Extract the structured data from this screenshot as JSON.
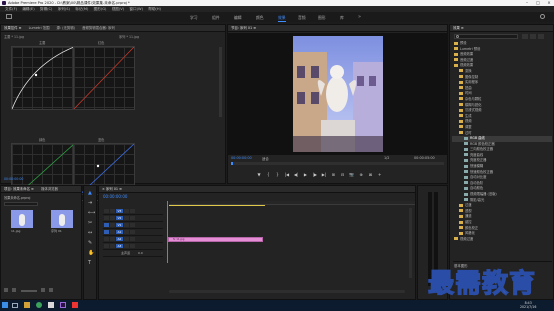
{
  "app": {
    "title": "Adobe Premiere Pro 2020 - D:\\教案\\00\\精品课件\\效果集-未命名.prproj *",
    "window_controls": [
      "–",
      "□",
      "×"
    ]
  },
  "menu": [
    "文件(F)",
    "编辑(E)",
    "剪辑(C)",
    "序列(S)",
    "标记(M)",
    "图形(G)",
    "视图(V)",
    "窗口(W)",
    "帮助(H)"
  ],
  "workspaces": [
    "学习",
    "组件",
    "编辑",
    "颜色",
    "效果",
    "音频",
    "图形",
    "库"
  ],
  "active_workspace": "效果",
  "effect_controls": {
    "tabs": [
      "效果控件 ≡",
      "Lumetri 范围",
      "源: (无剪辑)",
      "音频剪辑混合器: 序列"
    ],
    "header_left": "主要 * 11.jpg",
    "header_right": "序列 * 11.jpg",
    "graph_labels": [
      "主要",
      "红色",
      "绿色",
      "蓝色"
    ],
    "time": "00:00:00:00"
  },
  "program_monitor": {
    "title": "节目: 序列 01 ≡",
    "timecode": "00:00:00:00",
    "fit": "适合",
    "scale": "1/2",
    "duration": "00:00:05:00",
    "controls": [
      "▼",
      "{",
      "}",
      "|◀",
      "◀|",
      "▶",
      "|▶",
      "▶|",
      "⊞",
      "⊟",
      "📷",
      "⊕",
      "⊠",
      "+"
    ]
  },
  "effects_panel": {
    "title": "效果 ≡",
    "search_placeholder": "",
    "items": [
      {
        "label": "预设",
        "type": "folder",
        "indent": 0
      },
      {
        "label": "Lumetri 预设",
        "type": "folder",
        "indent": 0
      },
      {
        "label": "音频效果",
        "type": "folder",
        "indent": 0
      },
      {
        "label": "音频过渡",
        "type": "folder",
        "indent": 0
      },
      {
        "label": "视频效果",
        "type": "folder",
        "indent": 0
      },
      {
        "label": "变换",
        "type": "folder",
        "indent": 1
      },
      {
        "label": "图像控制",
        "type": "folder",
        "indent": 1
      },
      {
        "label": "实用程序",
        "type": "folder",
        "indent": 1
      },
      {
        "label": "扭曲",
        "type": "folder",
        "indent": 1
      },
      {
        "label": "时间",
        "type": "folder",
        "indent": 1
      },
      {
        "label": "杂色与颗粒",
        "type": "folder",
        "indent": 1
      },
      {
        "label": "模糊与锐化",
        "type": "folder",
        "indent": 1
      },
      {
        "label": "沉浸式视频",
        "type": "folder",
        "indent": 1
      },
      {
        "label": "生成",
        "type": "folder",
        "indent": 1
      },
      {
        "label": "视频",
        "type": "folder",
        "indent": 1
      },
      {
        "label": "调整",
        "type": "folder",
        "indent": 1
      },
      {
        "label": "过时",
        "type": "folder",
        "indent": 1
      },
      {
        "label": "RGB 曲线",
        "type": "fx",
        "indent": 2,
        "selected": true
      },
      {
        "label": "RGB 颜色校正器",
        "type": "fx",
        "indent": 2
      },
      {
        "label": "三向颜色校正器",
        "type": "fx",
        "indent": 2
      },
      {
        "label": "亮度曲线",
        "type": "fx",
        "indent": 2
      },
      {
        "label": "亮度校正器",
        "type": "fx",
        "indent": 2
      },
      {
        "label": "快速模糊",
        "type": "fx",
        "indent": 2
      },
      {
        "label": "快速颜色校正器",
        "type": "fx",
        "indent": 2
      },
      {
        "label": "自动对比度",
        "type": "fx",
        "indent": 2
      },
      {
        "label": "自动色阶",
        "type": "fx",
        "indent": 2
      },
      {
        "label": "自动颜色",
        "type": "fx",
        "indent": 2
      },
      {
        "label": "视频限幅器 (旧版)",
        "type": "fx",
        "indent": 2
      },
      {
        "label": "阴影/高光",
        "type": "fx",
        "indent": 2
      },
      {
        "label": "过渡",
        "type": "folder",
        "indent": 1
      },
      {
        "label": "透视",
        "type": "folder",
        "indent": 1
      },
      {
        "label": "通道",
        "type": "folder",
        "indent": 1
      },
      {
        "label": "键控",
        "type": "folder",
        "indent": 1
      },
      {
        "label": "颜色校正",
        "type": "folder",
        "indent": 1
      },
      {
        "label": "风格化",
        "type": "folder",
        "indent": 1
      },
      {
        "label": "视频过渡",
        "type": "folder",
        "indent": 0
      }
    ],
    "footer": "基本图形"
  },
  "project_panel": {
    "tabs": [
      "项目: 效果未命名 ≡",
      "媒体浏览器"
    ],
    "project_name": "效果未命名.prproj",
    "items": [
      "11.jpg",
      "序列 01"
    ]
  },
  "timeline": {
    "title": "× 序列 01 ≡",
    "timecode": "00:00:00:00",
    "video_tracks": [
      "V3",
      "V2",
      "V1"
    ],
    "audio_tracks": [
      "A1",
      "A2",
      "A3"
    ],
    "master": "主声道",
    "master_value": "0.0",
    "clip_label": "fx 11.jpg"
  },
  "watermark": {
    "text": "最需教育"
  },
  "taskbar": {
    "time": "8:43",
    "date": "2021/7/16"
  },
  "colors": {
    "accent": "#3d8cff",
    "clip": "#e58ed6",
    "timecode": "#3d8cff"
  }
}
